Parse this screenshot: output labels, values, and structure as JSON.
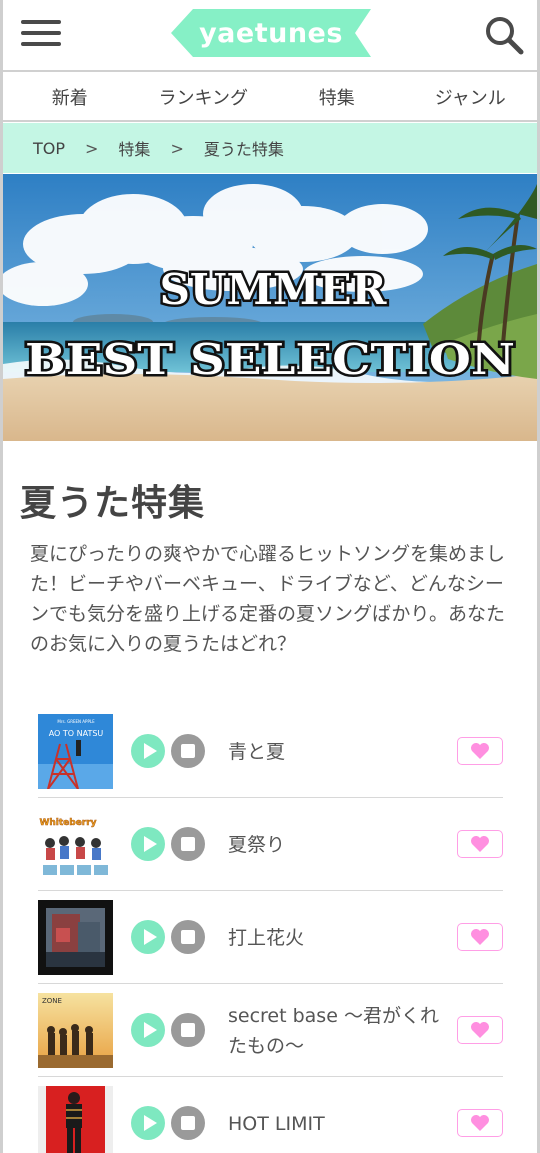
{
  "header": {
    "logo_text": "yaetunes",
    "menu_icon": "hamburger-menu-icon",
    "search_icon": "search-icon",
    "brand_color": "#86f0c6"
  },
  "nav": {
    "items": [
      {
        "label": "新着"
      },
      {
        "label": "ランキング"
      },
      {
        "label": "特集"
      },
      {
        "label": "ジャンル"
      }
    ]
  },
  "breadcrumb": {
    "items": [
      "TOP",
      "特集",
      "夏うた特集"
    ],
    "separator": ">",
    "background": "#c4f6e4"
  },
  "hero": {
    "line1": "SUMMER",
    "line2": "BEST SELECTION"
  },
  "feature": {
    "title": "夏うた特集",
    "description": "夏にぴったりの爽やかで心躍るヒットソングを集めました！ビーチやバーベキュー、ドライブなど、どんなシーンでも気分を盛り上げる定番の夏ソングばかり。あなたのお気に入りの夏うたはどれ？"
  },
  "songs": [
    {
      "title": "青と夏",
      "jacket_text": "AO TO NATSU",
      "jacket_sub": "Mrs. GREEN APPLE"
    },
    {
      "title": "夏祭り",
      "jacket_text": "Whiteberry"
    },
    {
      "title": "打上花火"
    },
    {
      "title": "secret base ～君がくれたもの～",
      "jacket_text": "ZONE"
    },
    {
      "title": "HOT LIMIT"
    }
  ],
  "colors": {
    "play": "#7ee8c0",
    "stop": "#9a9a9a",
    "fav_border": "#ff9ee6",
    "fav_heart": "#ff8fe0"
  }
}
